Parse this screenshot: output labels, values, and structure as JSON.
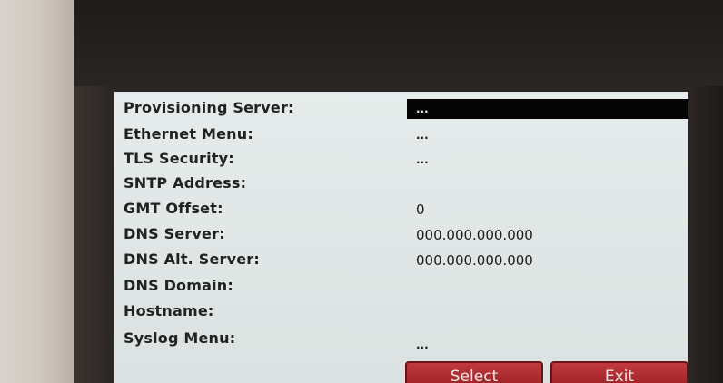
{
  "settings": {
    "rows": [
      {
        "label": "Provisioning Server:",
        "value": "...",
        "selected": true
      },
      {
        "label": "Ethernet Menu:",
        "value": "..."
      },
      {
        "label": "TLS Security:",
        "value": "..."
      },
      {
        "label": "SNTP Address:",
        "value": ""
      },
      {
        "label": "GMT Offset:",
        "value": "0"
      },
      {
        "label": "DNS Server:",
        "value": "000.000.000.000"
      },
      {
        "label": "DNS Alt. Server:",
        "value": "000.000.000.000"
      },
      {
        "label": "DNS Domain:",
        "value": ""
      },
      {
        "label": "Hostname:",
        "value": ""
      },
      {
        "label": "Syslog Menu:",
        "value": "..."
      }
    ]
  },
  "softkeys": {
    "select_label": "Select",
    "exit_label": "Exit"
  },
  "colors": {
    "screen_bg": "#e2e8e7",
    "selection_bg": "#050505",
    "softkey_red": "#b02f35"
  }
}
